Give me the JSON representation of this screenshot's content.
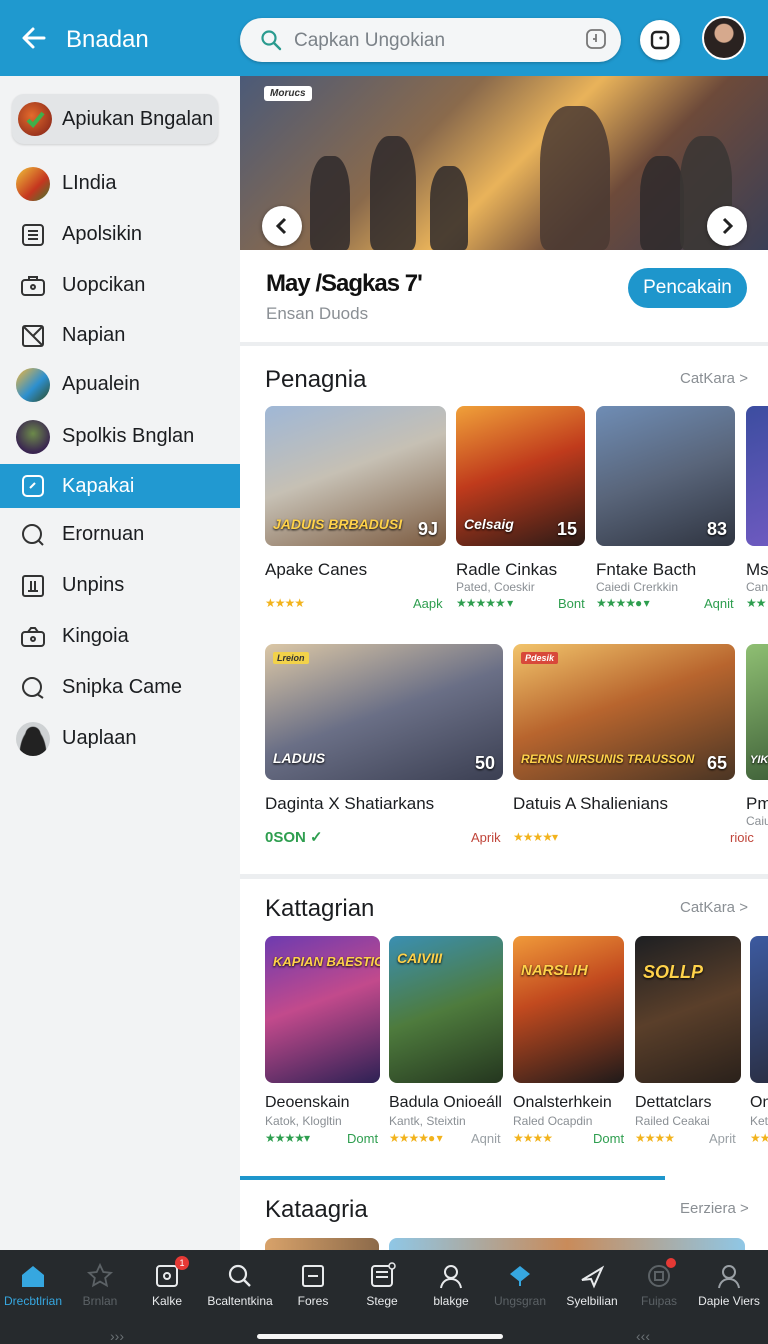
{
  "header": {
    "title": "Bnadan",
    "search_placeholder": "Capkan Ungokian"
  },
  "sidebar": {
    "items": [
      {
        "label": "Apiukan Bngalan"
      },
      {
        "label": "LIndia"
      },
      {
        "label": "Apolsikin"
      },
      {
        "label": "Uopcikan"
      },
      {
        "label": "Napian"
      },
      {
        "label": "Apualein"
      },
      {
        "label": "Spolkis Bnglan"
      },
      {
        "label": "Kapakai"
      },
      {
        "label": "Erornuan"
      },
      {
        "label": "Unpins"
      },
      {
        "label": "Kingoia"
      },
      {
        "label": "Snipka Came"
      },
      {
        "label": "Uaplaan"
      }
    ]
  },
  "banner": {
    "tag": "Morucs"
  },
  "featured": {
    "title": "May /Sagkas 7ʹ",
    "subtitle": "Ensan Duods",
    "button": "Pencakain"
  },
  "section1": {
    "title": "Penagnia",
    "link": "CatKara >",
    "cards": [
      {
        "name": "Apake Canes",
        "sub": "",
        "badge": "9J",
        "overlay": "JADUIS BRBADUSI",
        "stars": "★★★★",
        "meta": "Aapk"
      },
      {
        "name": "Radle Cinkas",
        "sub": "Pated, Coeskir",
        "badge": "15",
        "overlay": "Celsaig",
        "stars": "★★★★★ ▾",
        "meta": "Bont"
      },
      {
        "name": "Fntake Bacth",
        "sub": "Caiedi Crerkkin",
        "badge": "83",
        "overlay": "",
        "stars": "★★★★● ▾",
        "meta": "Aqnit"
      },
      {
        "name": "Ms",
        "sub": "Can",
        "badge": "",
        "overlay": "",
        "stars": "★★",
        "meta": ""
      }
    ]
  },
  "section2": {
    "cards": [
      {
        "name": "Daginta X Shatiarkans",
        "tag": "Lreion",
        "badge": "50",
        "overlay": "LADUIS",
        "meta_left": "0SON ✓",
        "meta": "Aprik"
      },
      {
        "name": "Datuis A Shalienians",
        "tag": "Pdesik",
        "badge": "65",
        "overlay": "RERNS NIRSUNIS TRAUSSON",
        "stars": "★★★★▾",
        "meta": ""
      },
      {
        "name": "Pm",
        "sub": "Caiu",
        "badge": "",
        "overlay": "YIK",
        "meta": "rioic"
      }
    ]
  },
  "section3": {
    "title": "Kattagrian",
    "link": "CatKara >",
    "cards": [
      {
        "name": "Deoenskain",
        "sub": "Katok, Klogltin",
        "overlay": "KAPIAN BAESTIOS",
        "stars": "★★★★▾",
        "meta": "Domt"
      },
      {
        "name": "Badula Onioeáll",
        "sub": "Kantk, Steixtin",
        "overlay": "CAIVIII",
        "stars": "★★★★● ▾",
        "meta": "Aqnit"
      },
      {
        "name": "Onalsterhkein",
        "sub": "Raled Ocapdin",
        "overlay": "NARSLIH",
        "stars": "★★★★",
        "meta": "Domt"
      },
      {
        "name": "Dettatclars",
        "sub": "Railed Ceakai",
        "overlay": "SOLLP",
        "stars": "★★★★",
        "meta": "Aprit"
      },
      {
        "name": "On",
        "sub": "Ket",
        "overlay": "",
        "stars": "★★",
        "meta": ""
      }
    ]
  },
  "section4": {
    "title": "Kataagria",
    "link": "Eerziera >"
  },
  "bottom_nav": [
    {
      "label": "Drecbtlrian"
    },
    {
      "label": "Brnlan"
    },
    {
      "label": "Kalke",
      "badge": "1"
    },
    {
      "label": "Bcaltentkina"
    },
    {
      "label": "Fores"
    },
    {
      "label": "Stege"
    },
    {
      "label": "blakge"
    },
    {
      "label": "Ungsgran"
    },
    {
      "label": "Syelbilian"
    },
    {
      "label": "Fuipas"
    },
    {
      "label": "Dapie Viers"
    }
  ],
  "colors": {
    "brand": "#1f99cf",
    "active": "#2199d1",
    "nav_bg": "#262a2d",
    "star": "#f2b31d",
    "star_green": "#2e9e4f"
  }
}
